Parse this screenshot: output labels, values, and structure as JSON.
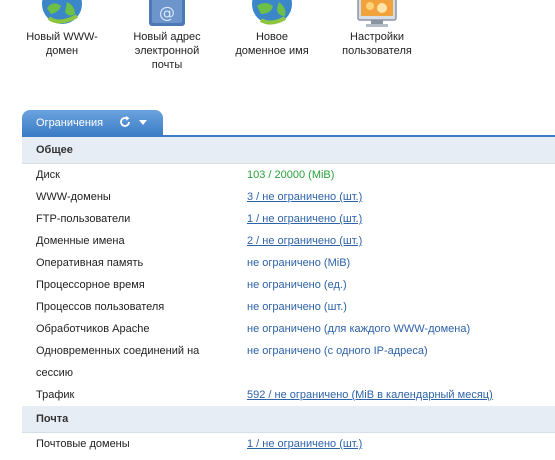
{
  "shortcuts": [
    {
      "icon": "globe-www-domain-icon",
      "label_line1": "Новый WWW-",
      "label_line2": "домен"
    },
    {
      "icon": "email-address-icon",
      "label_line1": "Новый адрес",
      "label_line2": "электронной",
      "label_line3": "почты"
    },
    {
      "icon": "globe-domain-name-icon",
      "label_line1": "Новое",
      "label_line2": "доменное имя"
    },
    {
      "icon": "user-settings-icon",
      "label_line1": "Настройки",
      "label_line2": "пользователя"
    }
  ],
  "tab": {
    "label": "Ограничения",
    "refresh_icon": "refresh-icon",
    "dropdown_icon": "chevron-down-icon"
  },
  "sections": {
    "general": {
      "title": "Общее",
      "rows": [
        {
          "key": "Диск",
          "value": "103 / 20000 (MiB)"
        },
        {
          "key": "WWW-домены",
          "value": "3 / не ограничено (шт.)"
        },
        {
          "key": "FTP-пользователи",
          "value": "1 / не ограничено (шт.)"
        },
        {
          "key": "Доменные имена",
          "value": "2 / не ограничено (шт.)"
        },
        {
          "key": "Оперативная память",
          "value": "не ограничено (MiB)"
        },
        {
          "key": "Процессорное время",
          "value": "не ограничено (ед.)"
        },
        {
          "key": "Процессов пользователя",
          "value": "не ограничено (шт.)"
        },
        {
          "key": "Обработчиков Apache",
          "value": "не ограничено (для каждого WWW-домена)"
        },
        {
          "key_line1": "Одновременных соединений на",
          "key_line2": "сессию",
          "value": "не ограничено (с одного IP-адреса)"
        },
        {
          "key": "Трафик",
          "value": "592 / не ограничено (MiB в календарный месяц)"
        }
      ]
    },
    "mail": {
      "title": "Почта",
      "rows": [
        {
          "key": "Почтовые домены",
          "value": "1 / не ограничено (шт.)"
        }
      ]
    }
  },
  "colors": {
    "tab_blue": "#3c7cc6",
    "section_bg": "#e7edf5",
    "link_blue": "#2e63a8",
    "disk_green": "#28a03c"
  }
}
